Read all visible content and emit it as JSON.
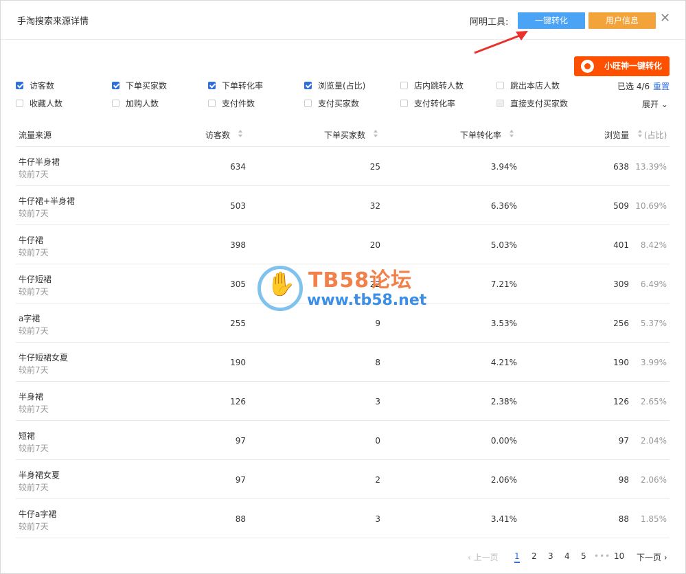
{
  "header": {
    "title": "手淘搜索来源详情",
    "tool_label": "阿明工具:",
    "btn_convert": "一键转化",
    "btn_userinfo": "用户信息",
    "close_icon": "close-icon"
  },
  "wangwang_button": {
    "label": "小旺神一键转化",
    "icon": "wangwang-logo-icon"
  },
  "filters": {
    "row1": [
      {
        "label": "访客数",
        "checked": true
      },
      {
        "label": "下单买家数",
        "checked": true
      },
      {
        "label": "下单转化率",
        "checked": true
      },
      {
        "label": "浏览量(占比)",
        "checked": true
      },
      {
        "label": "店内跳转人数",
        "checked": false
      },
      {
        "label": "跳出本店人数",
        "checked": false
      }
    ],
    "row2": [
      {
        "label": "收藏人数",
        "checked": false
      },
      {
        "label": "加购人数",
        "checked": false
      },
      {
        "label": "支付件数",
        "checked": false
      },
      {
        "label": "支付买家数",
        "checked": false
      },
      {
        "label": "支付转化率",
        "checked": false
      },
      {
        "label": "直接支付买家数",
        "checked": false,
        "disabled": true
      }
    ],
    "selected_text": "已选 4/6",
    "reset_label": "重置",
    "expand_label": "展开"
  },
  "table": {
    "columns": [
      "流量来源",
      "访客数",
      "下单买家数",
      "下单转化率",
      "浏览量",
      "(占比)"
    ],
    "rows": [
      {
        "source": "牛仔半身裙",
        "sub": "较前7天",
        "visitors": "634",
        "buyers": "25",
        "rate": "3.94%",
        "views": "638",
        "share": "13.39%"
      },
      {
        "source": "牛仔裙+半身裙",
        "sub": "较前7天",
        "visitors": "503",
        "buyers": "32",
        "rate": "6.36%",
        "views": "509",
        "share": "10.69%"
      },
      {
        "source": "牛仔裙",
        "sub": "较前7天",
        "visitors": "398",
        "buyers": "20",
        "rate": "5.03%",
        "views": "401",
        "share": "8.42%"
      },
      {
        "source": "牛仔短裙",
        "sub": "较前7天",
        "visitors": "305",
        "buyers": "22",
        "rate": "7.21%",
        "views": "309",
        "share": "6.49%"
      },
      {
        "source": "a字裙",
        "sub": "较前7天",
        "visitors": "255",
        "buyers": "9",
        "rate": "3.53%",
        "views": "256",
        "share": "5.37%"
      },
      {
        "source": "牛仔短裙女夏",
        "sub": "较前7天",
        "visitors": "190",
        "buyers": "8",
        "rate": "4.21%",
        "views": "190",
        "share": "3.99%"
      },
      {
        "source": "半身裙",
        "sub": "较前7天",
        "visitors": "126",
        "buyers": "3",
        "rate": "2.38%",
        "views": "126",
        "share": "2.65%"
      },
      {
        "source": "短裙",
        "sub": "较前7天",
        "visitors": "97",
        "buyers": "0",
        "rate": "0.00%",
        "views": "97",
        "share": "2.04%"
      },
      {
        "source": "半身裙女夏",
        "sub": "较前7天",
        "visitors": "97",
        "buyers": "2",
        "rate": "2.06%",
        "views": "98",
        "share": "2.06%"
      },
      {
        "source": "牛仔a字裙",
        "sub": "较前7天",
        "visitors": "88",
        "buyers": "3",
        "rate": "3.41%",
        "views": "88",
        "share": "1.85%"
      }
    ]
  },
  "pagination": {
    "prev": "上一页",
    "pages": [
      "1",
      "2",
      "3",
      "4",
      "5"
    ],
    "ellipsis": "•••",
    "last": "10",
    "next": "下一页",
    "current": "1"
  },
  "watermark": {
    "title": "TB58论坛",
    "url": "www.tb58.net"
  },
  "colors": {
    "accent_blue": "#4aa3f5",
    "accent_orange": "#f2a43a",
    "wangwang_orange": "#ff5000",
    "checkbox_blue": "#2f6fdd"
  }
}
